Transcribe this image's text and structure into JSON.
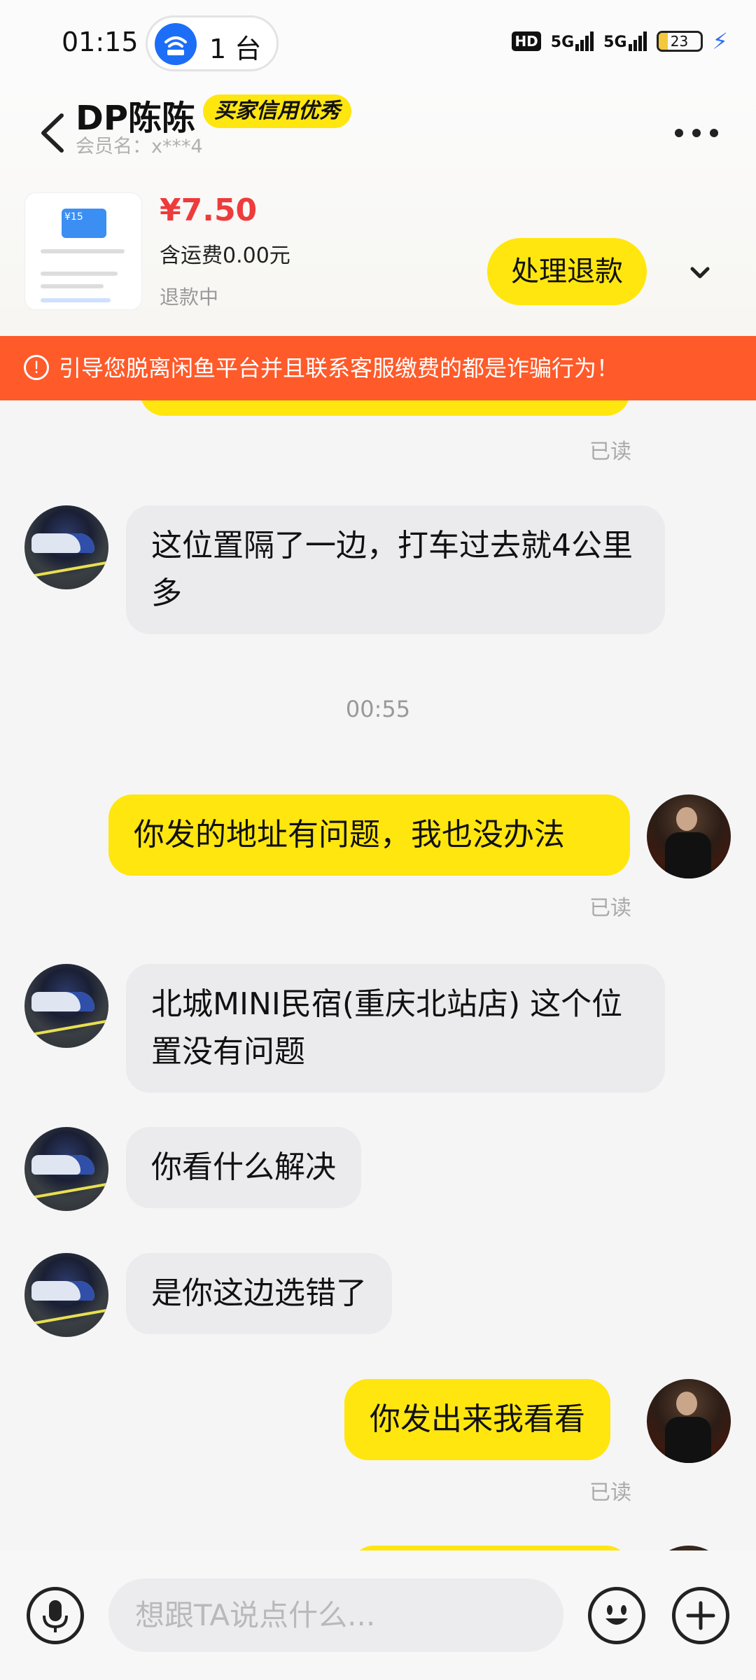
{
  "status_bar": {
    "time": "01:15",
    "hotspot_count": "1 台",
    "hd_label": "HD",
    "signal_1": "5G",
    "signal_2": "5G",
    "battery": "23"
  },
  "header": {
    "back_icon": "chevron-left-icon",
    "contact_name": "DP陈陈",
    "credit_badge": "买家信用优秀",
    "member_line": "会员名：x***4",
    "more_icon": "more-horizontal-icon"
  },
  "order": {
    "price": "¥7.50",
    "shipping": "含运费0.00元",
    "status": "退款中",
    "refund_button": "处理退款",
    "thumb_card_text": "¥15",
    "expand_icon": "chevron-down-icon"
  },
  "warning": {
    "icon": "alert-circle-icon",
    "text": "引导您脱离闲鱼平台并且联系客服缴费的都是诈骗行为！"
  },
  "messages": [
    {
      "side": "out",
      "read": "已读"
    },
    {
      "side": "in",
      "text": "这位置隔了一边，打车过去就4公里多"
    },
    {
      "timestamp": "00:55"
    },
    {
      "side": "out",
      "text": "你发的地址有问题，我也没办法",
      "read": "已读"
    },
    {
      "side": "in",
      "text": "北城MINI民宿(重庆北站店) 这个位置没有问题"
    },
    {
      "side": "in",
      "text": "你看什么解决"
    },
    {
      "side": "in",
      "text": "是你这边选错了"
    },
    {
      "side": "out",
      "text": "你发出来我看看",
      "read": "已读"
    }
  ],
  "input_bar": {
    "placeholder": "想跟TA说点什么...",
    "mic_icon": "microphone-icon",
    "emoji_icon": "emoji-icon",
    "plus_icon": "plus-icon"
  },
  "colors": {
    "accent_yellow": "#ffe60f",
    "warning_orange": "#ff5a2a",
    "price_red": "#ee3b3b",
    "incoming_bubble": "#ebebed"
  }
}
